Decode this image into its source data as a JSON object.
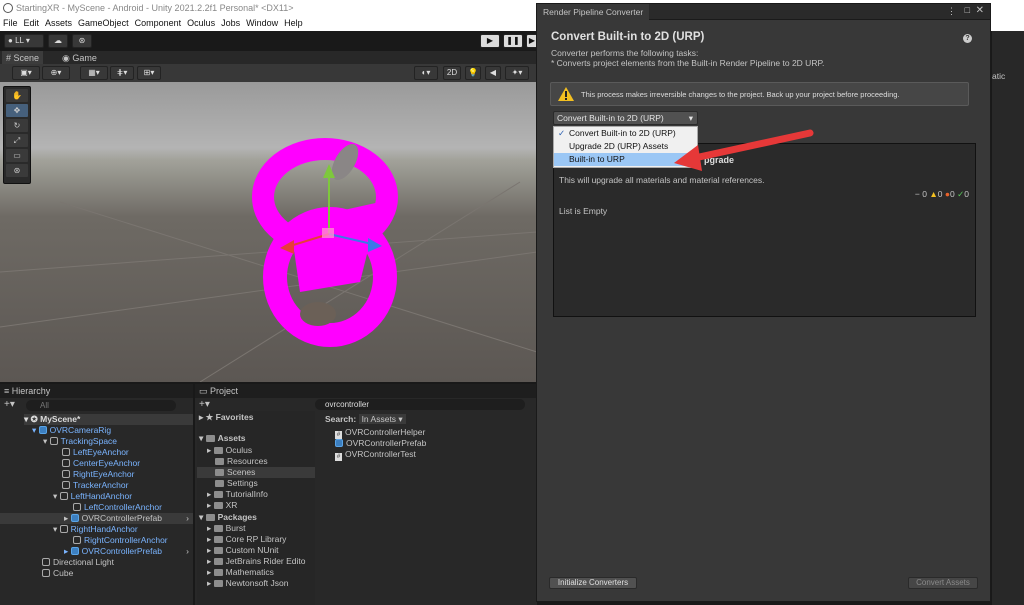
{
  "window": {
    "title": "StartingXR - MyScene - Android - Unity 2021.2.2f1 Personal* <DX11>"
  },
  "menu": [
    "File",
    "Edit",
    "Assets",
    "GameObject",
    "Component",
    "Oculus",
    "Jobs",
    "Window",
    "Help"
  ],
  "toolbar": {
    "account": "LL",
    "play_icon": "play-icon",
    "pause_icon": "pause-icon",
    "step_icon": "step-icon"
  },
  "scene_tabs": [
    "Scene",
    "Game"
  ],
  "scene_toolbar": {
    "mode_2d": "2D"
  },
  "hierarchy": {
    "title": "Hierarchy",
    "search_placeholder": "All",
    "items": [
      {
        "label": "MyScene*",
        "depth": 0
      },
      {
        "label": "OVRCameraRig",
        "depth": 1
      },
      {
        "label": "TrackingSpace",
        "depth": 2
      },
      {
        "label": "LeftEyeAnchor",
        "depth": 3
      },
      {
        "label": "CenterEyeAnchor",
        "depth": 3
      },
      {
        "label": "RightEyeAnchor",
        "depth": 3
      },
      {
        "label": "TrackerAnchor",
        "depth": 3
      },
      {
        "label": "LeftHandAnchor",
        "depth": 3
      },
      {
        "label": "LeftControllerAnchor",
        "depth": 4
      },
      {
        "label": "OVRControllerPrefab",
        "depth": 4
      },
      {
        "label": "RightHandAnchor",
        "depth": 3
      },
      {
        "label": "RightControllerAnchor",
        "depth": 4
      },
      {
        "label": "OVRControllerPrefab",
        "depth": 4
      },
      {
        "label": "Directional Light",
        "depth": 1
      },
      {
        "label": "Cube",
        "depth": 1
      }
    ]
  },
  "project": {
    "title": "Project",
    "search_value": "ovrcontroller",
    "search_label": "Search:",
    "search_scope": "In Assets",
    "favorites": "Favorites",
    "assets": "Assets",
    "asset_folders": [
      "Oculus",
      "Resources",
      "Scenes",
      "Settings",
      "TutorialInfo",
      "XR"
    ],
    "packages": "Packages",
    "package_folders": [
      "Burst",
      "Core RP Library",
      "Custom NUnit",
      "JetBrains Rider Edito",
      "Mathematics",
      "Newtonsoft Json"
    ],
    "results": [
      "OVRControllerHelper",
      "OVRControllerPrefab",
      "OVRControllerTest"
    ]
  },
  "converter": {
    "tab": "Render Pipeline Converter",
    "heading": "Convert Built-in to 2D (URP)",
    "description_line1": "Converter performs the following tasks:",
    "description_line2": "* Converts project elements from the Built-in Render Pipeline to 2D URP.",
    "warning": "This process makes irreversible changes to the project. Back up your project before proceeding.",
    "dropdown_value": "Convert Built-in to 2D (URP)",
    "dropdown_options": [
      "Convert Built-in to 2D (URP)",
      "Upgrade 2D (URP) Assets",
      "Built-in to URP"
    ],
    "section_suffix": "pgrade",
    "section_text": "This will upgrade all materials and material references.",
    "counts": {
      "pending": "0",
      "warnings": "0",
      "errors": "0",
      "success": "0"
    },
    "list_empty": "List is Empty",
    "initialize_button": "Initialize Converters",
    "convert_button": "Convert Assets"
  },
  "right_panel": {
    "partial_label": "atic"
  },
  "colors": {
    "accent_blue": "#3c7fc0",
    "magenta": "#ff00ff",
    "arrow_red": "#e63838"
  }
}
